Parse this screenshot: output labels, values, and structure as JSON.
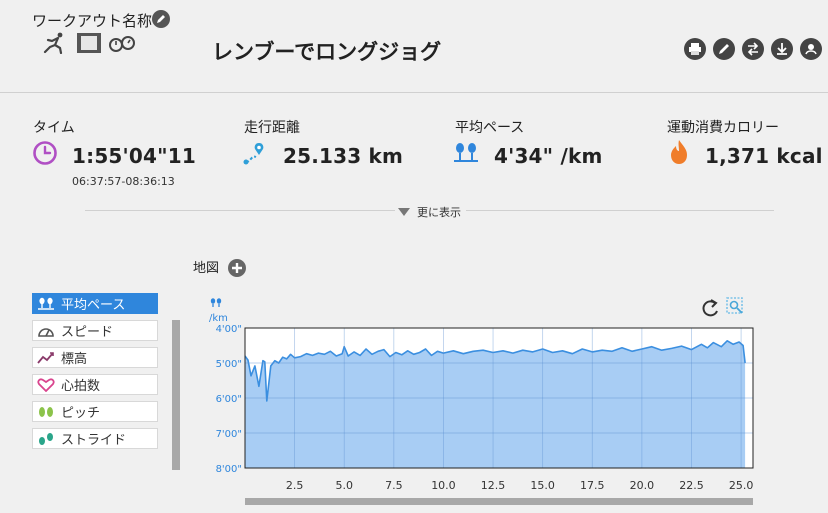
{
  "header": {
    "workout_name_label": "ワークアウト名称",
    "workout_title": "レンブーでロングジョグ"
  },
  "stats": [
    {
      "label": "タイム",
      "value": "1:55'04\"11",
      "sub": "06:37:57-08:36:13",
      "icon": "clock-icon",
      "color": "#b04fc4"
    },
    {
      "label": "走行距離",
      "value": "25.133 km",
      "icon": "route-pin-icon",
      "color": "#2f9fd8"
    },
    {
      "label": "平均ペース",
      "value": "4'34\" /km",
      "icon": "footprint-pace-icon",
      "color": "#2f86dc"
    },
    {
      "label": "運動消費カロリー",
      "value": "1,371 kcal",
      "icon": "flame-icon",
      "color": "#f07d2a"
    }
  ],
  "more_label": "更に表示",
  "map_label": "地図",
  "sidebar": {
    "items": [
      {
        "label": "平均ペース",
        "icon": "footprint-pace-icon",
        "active": true
      },
      {
        "label": "スピード",
        "icon": "speedometer-icon",
        "active": false
      },
      {
        "label": "標高",
        "icon": "elevation-trend-icon",
        "active": false
      },
      {
        "label": "心拍数",
        "icon": "heart-icon",
        "active": false
      },
      {
        "label": "ピッチ",
        "icon": "pitch-footprint-icon",
        "active": false
      },
      {
        "label": "ストライド",
        "icon": "stride-footprint-icon",
        "active": false
      }
    ]
  },
  "chart_data": {
    "type": "area",
    "y_unit_label": "/km",
    "y_ticks": [
      "4'00\"",
      "5'00\"",
      "6'00\"",
      "7'00\"",
      "8'00\""
    ],
    "y_range_sec_per_km": [
      240,
      480
    ],
    "y_inverted": true,
    "x_range_km": [
      0,
      25.6
    ],
    "x_ticks": [
      "2.5",
      "5.0",
      "7.5",
      "10.0",
      "12.5",
      "15.0",
      "17.5",
      "20.0",
      "22.5",
      "25.0"
    ],
    "x_tick_values": [
      2.5,
      5.0,
      7.5,
      10.0,
      12.5,
      15.0,
      17.5,
      20.0,
      22.5,
      25.0
    ],
    "grid": true,
    "series_color": "#3b8fe0",
    "fill_color": "#a8cdf4",
    "x": [
      0,
      0.15,
      0.3,
      0.5,
      0.7,
      0.9,
      1.0,
      1.1,
      1.3,
      1.5,
      1.7,
      1.9,
      2.1,
      2.3,
      2.5,
      2.8,
      3.1,
      3.4,
      3.7,
      4.0,
      4.3,
      4.6,
      4.9,
      5.0,
      5.2,
      5.5,
      5.8,
      6.1,
      6.4,
      6.7,
      7.0,
      7.3,
      7.6,
      7.9,
      8.2,
      8.5,
      8.8,
      9.1,
      9.4,
      9.7,
      10.0,
      10.5,
      11.0,
      11.5,
      12.0,
      12.5,
      13.0,
      13.5,
      14.0,
      14.5,
      15.0,
      15.5,
      16.0,
      16.5,
      17.0,
      17.5,
      18.0,
      18.5,
      19.0,
      19.5,
      20.0,
      20.5,
      21.0,
      21.5,
      22.0,
      22.5,
      23.0,
      23.3,
      23.6,
      24.0,
      24.3,
      24.6,
      24.9,
      25.1,
      25.2
    ],
    "y": [
      288,
      295,
      322,
      305,
      340,
      296,
      298,
      365,
      305,
      296,
      300,
      290,
      293,
      285,
      291,
      289,
      284,
      287,
      283,
      285,
      280,
      288,
      284,
      272,
      288,
      281,
      287,
      276,
      285,
      280,
      277,
      289,
      282,
      286,
      279,
      285,
      282,
      276,
      287,
      280,
      283,
      279,
      284,
      280,
      278,
      282,
      279,
      283,
      278,
      281,
      276,
      282,
      279,
      284,
      276,
      281,
      278,
      280,
      274,
      280,
      276,
      272,
      278,
      275,
      271,
      277,
      268,
      274,
      265,
      272,
      262,
      268,
      264,
      270,
      300
    ]
  }
}
